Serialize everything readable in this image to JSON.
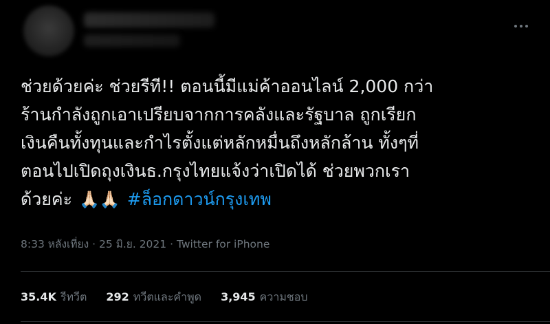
{
  "tweet": {
    "lines": [
      "ช่วยด้วยค่ะ ช่วยรีที!! ตอนนี้มีแม่ค้าออนไลน์ 2,000 กว่า",
      "ร้านกำลังถูกเอาเปรียบจากการคลังและรัฐบาล ถูกเรียก",
      "เงินคืนทั้งทุนและกำไรตั้งแต่หลักหมื่นถึงหลักล้าน ทั้งๆที่",
      "ตอนไปเปิดถุงเงินธ.กรุงไทยแจ้งว่าเปิดได้ ช่วยพวกเรา"
    ],
    "last_line_text": "ด้วยค่ะ",
    "emoji": "🙏🏻🙏🏻",
    "hashtag": "#ล็อกดาวน์กรุงเทพ"
  },
  "meta": {
    "time": "8:33 หลังเที่ยง",
    "sep1": " · ",
    "date": "25 มิ.ย. 2021",
    "sep2": " · ",
    "source": "Twitter for iPhone"
  },
  "stats": {
    "retweets_count": "35.4K",
    "retweets_label": "รีทวีต",
    "quotes_count": "292",
    "quotes_label": "ทวีตและคำพูด",
    "likes_count": "3,945",
    "likes_label": "ความชอบ"
  },
  "icons": {
    "more": "more-horizontal-icon"
  },
  "colors": {
    "background": "#000000",
    "text": "#e7e9ea",
    "muted": "#6e767d",
    "link": "#1d9bf0",
    "divider": "#2f3336"
  }
}
